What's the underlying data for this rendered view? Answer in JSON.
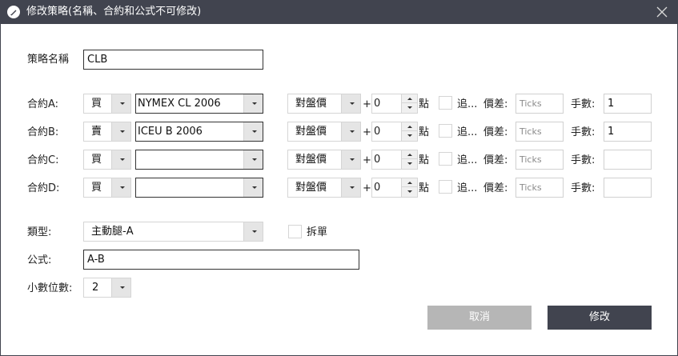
{
  "window": {
    "title": "修改策略(名稱、合約和公式不可修改)"
  },
  "strategy_name": {
    "label": "策略名稱",
    "value": "CLB"
  },
  "legs": [
    {
      "label": "合約A:",
      "side": "買",
      "contract": "NYMEX CL 2006",
      "price_type": "對盤價",
      "plus": "+",
      "offset": "0",
      "offset_unit": "點",
      "chase_label": "追...",
      "slippage_label": "價差:",
      "slippage_placeholder": "Ticks",
      "qty_label": "手數:",
      "qty": "1"
    },
    {
      "label": "合約B:",
      "side": "賣",
      "contract": "ICEU B 2006",
      "price_type": "對盤價",
      "plus": "+",
      "offset": "0",
      "offset_unit": "點",
      "chase_label": "追...",
      "slippage_label": "價差:",
      "slippage_placeholder": "Ticks",
      "qty_label": "手數:",
      "qty": "1"
    },
    {
      "label": "合約C:",
      "side": "買",
      "contract": "",
      "price_type": "對盤價",
      "plus": "+",
      "offset": "0",
      "offset_unit": "點",
      "chase_label": "追...",
      "slippage_label": "價差:",
      "slippage_placeholder": "Ticks",
      "qty_label": "手數:",
      "qty": ""
    },
    {
      "label": "合約D:",
      "side": "買",
      "contract": "",
      "price_type": "對盤價",
      "plus": "+",
      "offset": "0",
      "offset_unit": "點",
      "chase_label": "追...",
      "slippage_label": "價差:",
      "slippage_placeholder": "Ticks",
      "qty_label": "手數:",
      "qty": ""
    }
  ],
  "type": {
    "label": "類型:",
    "value": "主動腿-A",
    "split_label": "拆單"
  },
  "formula": {
    "label": "公式:",
    "value": "A-B"
  },
  "decimals": {
    "label": "小數位數:",
    "value": "2"
  },
  "buttons": {
    "cancel": "取消",
    "ok": "修改"
  },
  "colors": {
    "titlebar": "#41444f",
    "cancel_button": "#b6b6b6",
    "ok_button": "#41444f"
  }
}
